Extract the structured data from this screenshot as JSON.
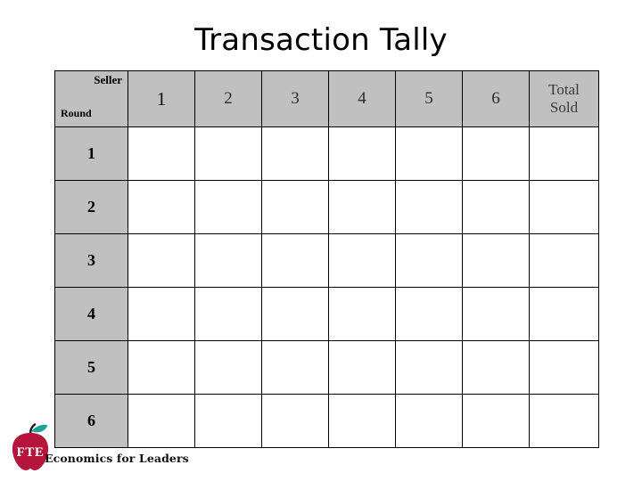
{
  "slide": {
    "title": "Transaction Tally",
    "background_color": "#ffffff"
  },
  "table": {
    "corner": {
      "top_right_label": "Seller",
      "bottom_left_label": "Round"
    },
    "header_background": "#c0c0c0",
    "border_color": "#000000",
    "seller_columns": [
      "1",
      "2",
      "3",
      "4",
      "5",
      "6"
    ],
    "total_column": {
      "line1": "Total",
      "line2": "Sold"
    },
    "rounds": [
      "1",
      "2",
      "3",
      "4",
      "5",
      "6"
    ],
    "cell_values": [
      [
        "",
        "",
        "",
        "",
        "",
        "",
        ""
      ],
      [
        "",
        "",
        "",
        "",
        "",
        "",
        ""
      ],
      [
        "",
        "",
        "",
        "",
        "",
        "",
        ""
      ],
      [
        "",
        "",
        "",
        "",
        "",
        "",
        ""
      ],
      [
        "",
        "",
        "",
        "",
        "",
        "",
        ""
      ],
      [
        "",
        "",
        "",
        "",
        "",
        "",
        ""
      ]
    ]
  },
  "footer": {
    "organization": "Economics for Leaders",
    "logo": {
      "monogram": "FTE",
      "apple_color": "#b5153c",
      "leaf_color": "#1aa39a",
      "stem_color": "#1f1f1f",
      "monogram_color": "#ffffff"
    }
  }
}
